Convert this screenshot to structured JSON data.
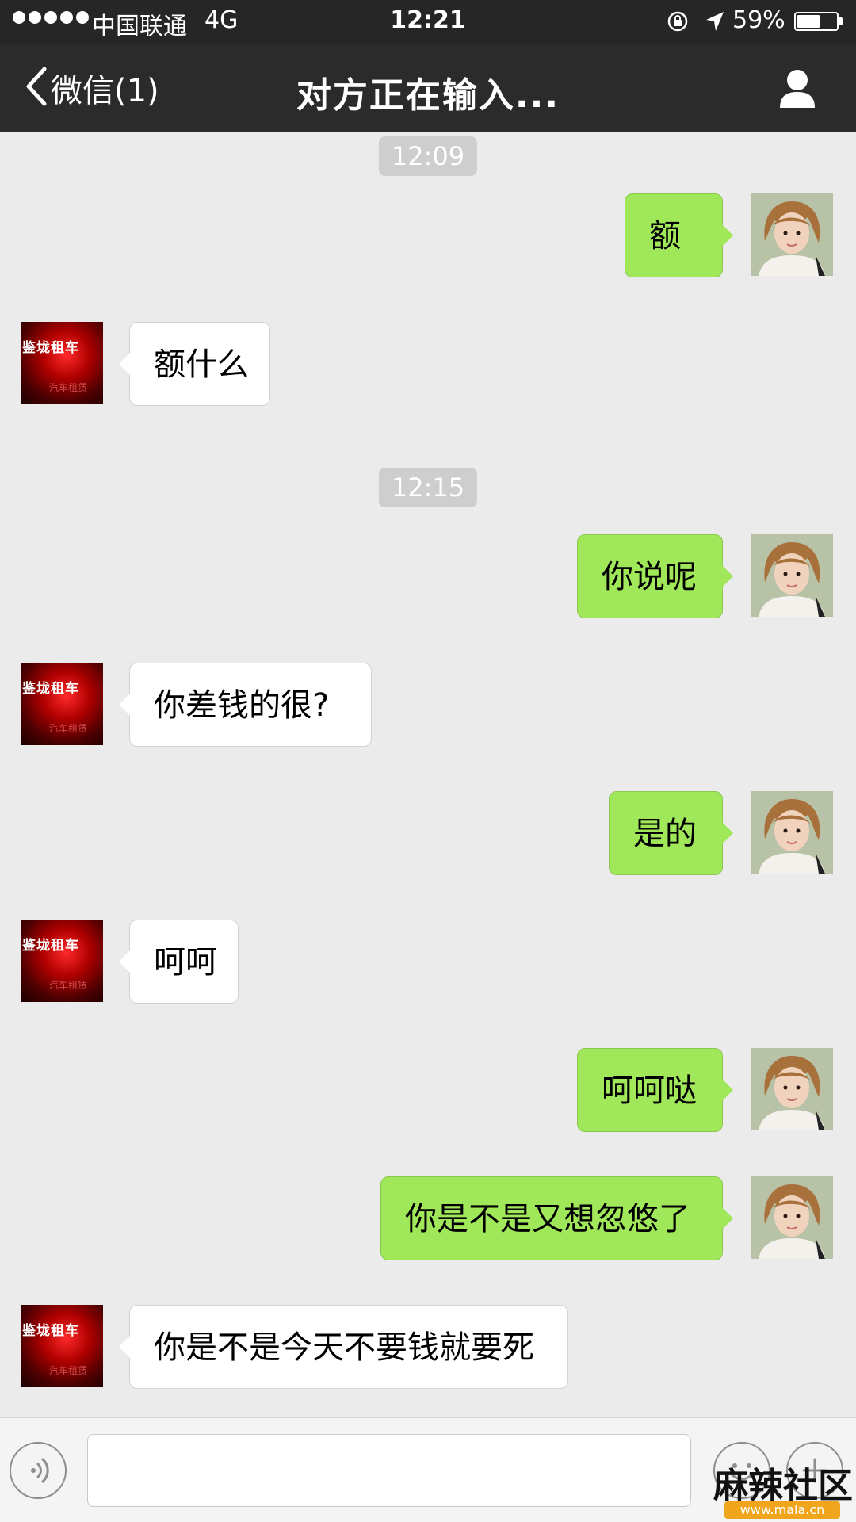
{
  "status_bar": {
    "carrier": "中国联通",
    "network": "4G",
    "time": "12:21",
    "battery": "59%",
    "battery_level": 0.59
  },
  "nav": {
    "back_label": "微信(1)",
    "title": "对方正在输入..."
  },
  "messages": [
    {
      "kind": "time",
      "text": "12:09"
    },
    {
      "kind": "sent",
      "text": "额"
    },
    {
      "kind": "received",
      "text": "额什么"
    },
    {
      "kind": "time",
      "text": "12:15"
    },
    {
      "kind": "sent",
      "text": "你说呢"
    },
    {
      "kind": "received",
      "text": "你差钱的很?"
    },
    {
      "kind": "sent",
      "text": "是的"
    },
    {
      "kind": "received",
      "text": "呵呵"
    },
    {
      "kind": "sent",
      "text": "呵呵哒"
    },
    {
      "kind": "sent",
      "text": "你是不是又想忽悠了"
    },
    {
      "kind": "received",
      "text": "你是不是今天不要钱就要死"
    }
  ],
  "contact_avatar": {
    "label": "鉴垅租车",
    "sub_label": "汽车租赁"
  },
  "input": {
    "value": ""
  },
  "watermark": {
    "text": "麻辣社区",
    "url": "www.mala.cn"
  },
  "colors": {
    "nav_background": "#2b2b2b",
    "chat_background": "#ebebeb",
    "sent_bubble": "#a0e75a",
    "received_bubble": "#ffffff"
  }
}
